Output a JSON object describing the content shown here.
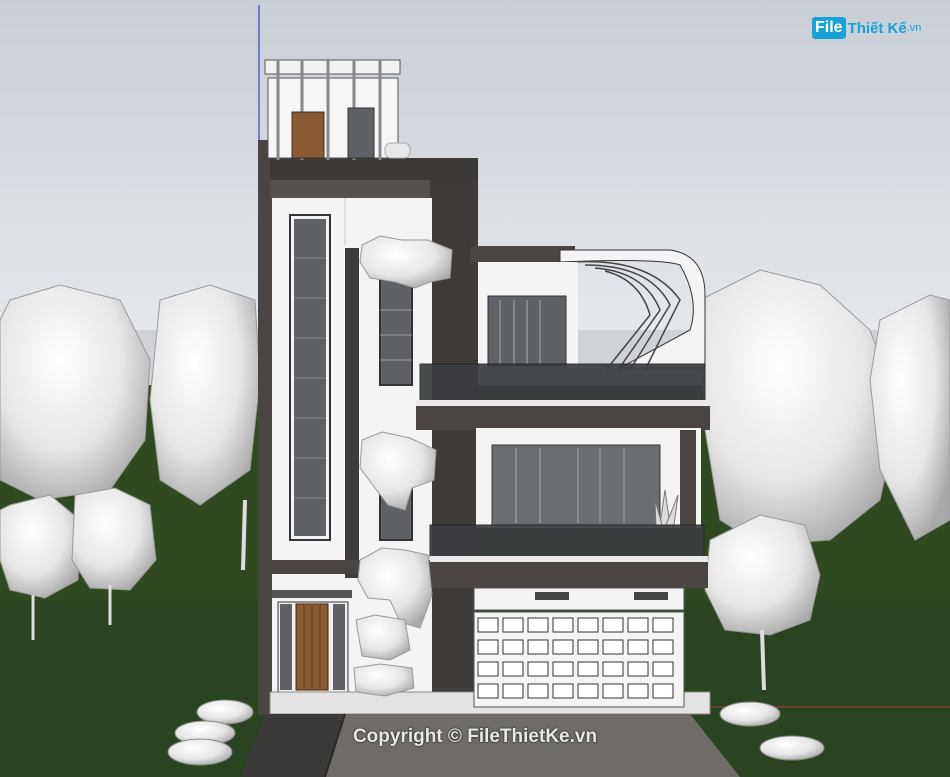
{
  "logo": {
    "badge": "File",
    "text": "Thiết Kế",
    "suffix": ".vn"
  },
  "watermark": "Copyright © FileThietKe.vn",
  "colors": {
    "sky": "#d9dde3",
    "grass": "#2e4a1f",
    "wall_dark": "#4a4542",
    "wall_white": "#f4f4f4",
    "glass": "#6b6f74",
    "wood": "#8a5a33",
    "brand": "#17a2d8"
  }
}
